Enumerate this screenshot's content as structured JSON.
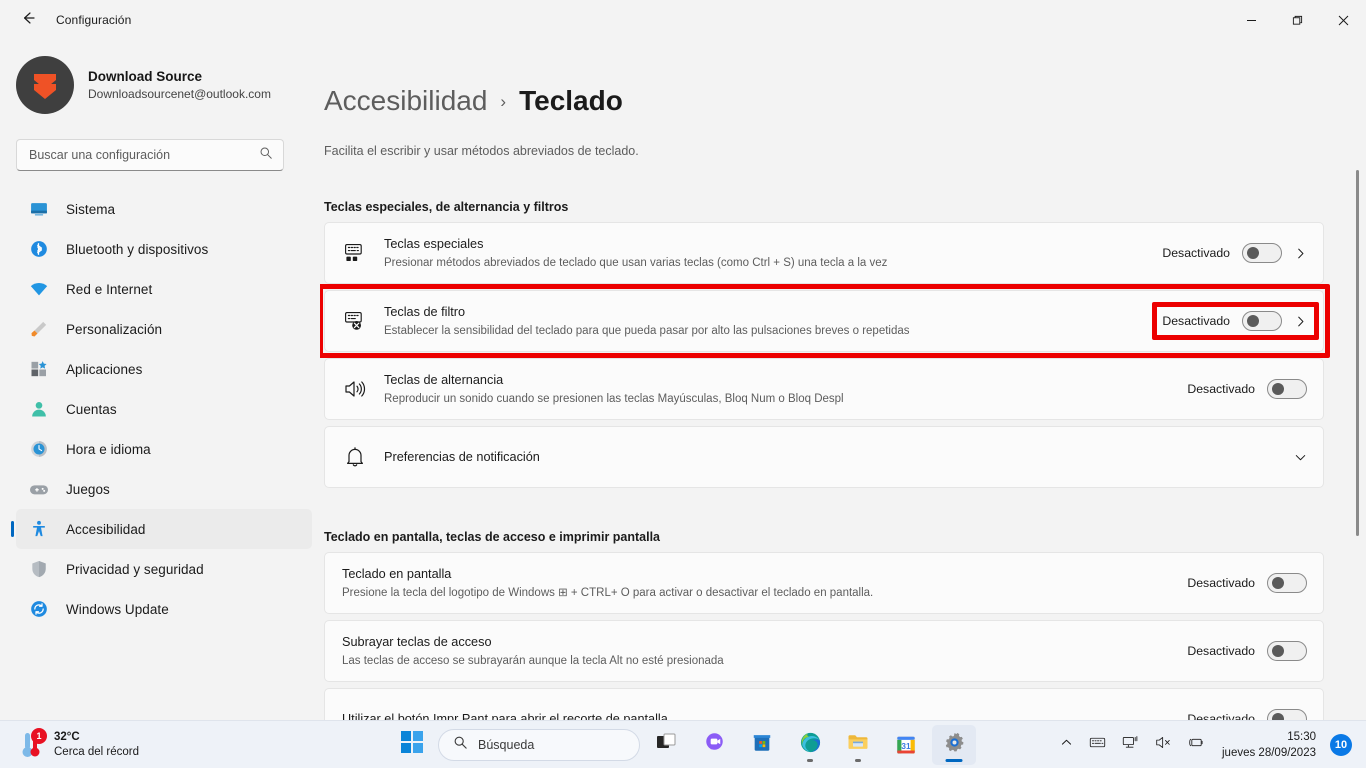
{
  "window": {
    "title": "Configuración",
    "back_icon": "back-arrow-icon",
    "minimize": "minimize-icon",
    "restore": "restore-icon",
    "close": "close-icon"
  },
  "account": {
    "name": "Download Source",
    "email": "Downloadsourcenet@outlook.com",
    "avatar_bg": "#3f3f3f",
    "avatar_accent": "#ef5226"
  },
  "search": {
    "placeholder": "Buscar una configuración",
    "value": "",
    "icon": "search-icon"
  },
  "sidebar": {
    "items": [
      {
        "label": "Sistema",
        "icon": "system-icon",
        "active": false
      },
      {
        "label": "Bluetooth y dispositivos",
        "icon": "bluetooth-icon",
        "active": false
      },
      {
        "label": "Red e Internet",
        "icon": "wifi-icon",
        "active": false
      },
      {
        "label": "Personalización",
        "icon": "brush-icon",
        "active": false
      },
      {
        "label": "Aplicaciones",
        "icon": "apps-icon",
        "active": false
      },
      {
        "label": "Cuentas",
        "icon": "account-icon",
        "active": false
      },
      {
        "label": "Hora e idioma",
        "icon": "clock-icon",
        "active": false
      },
      {
        "label": "Juegos",
        "icon": "gamepad-icon",
        "active": false
      },
      {
        "label": "Accesibilidad",
        "icon": "accessibility-icon",
        "active": true
      },
      {
        "label": "Privacidad y seguridad",
        "icon": "shield-icon",
        "active": false
      },
      {
        "label": "Windows Update",
        "icon": "update-icon",
        "active": false
      }
    ]
  },
  "page": {
    "breadcrumb_parent": "Accesibilidad",
    "breadcrumb_separator": "›",
    "breadcrumb_current": "Teclado",
    "description": "Facilita el escribir y usar métodos abreviados de teclado."
  },
  "sections": [
    {
      "title": "Teclas especiales, de alternancia y filtros",
      "rows": [
        {
          "name": "sticky-keys",
          "icon": "keyboard-sticky-icon",
          "title": "Teclas especiales",
          "subtitle": "Presionar métodos abreviados de teclado que usan varias teclas (como Ctrl + S) una tecla a la vez",
          "toggle_label": "Desactivado",
          "toggle_on": false,
          "chevron": "chevron-right-icon"
        },
        {
          "name": "filter-keys",
          "icon": "keyboard-filter-icon",
          "title": "Teclas de filtro",
          "subtitle": "Establecer la sensibilidad del teclado para que pueda pasar por alto las pulsaciones breves o repetidas",
          "toggle_label": "Desactivado",
          "toggle_on": false,
          "chevron": "chevron-right-icon",
          "highlighted": true
        },
        {
          "name": "toggle-keys",
          "icon": "speaker-icon",
          "title": "Teclas de alternancia",
          "subtitle": "Reproducir un sonido cuando se presionen las teclas Mayúsculas, Bloq Num o Bloq Despl",
          "toggle_label": "Desactivado",
          "toggle_on": false,
          "chevron": null
        },
        {
          "name": "notification-preferences",
          "icon": "bell-icon",
          "title": "Preferencias de notificación",
          "subtitle": null,
          "toggle_label": null,
          "toggle_on": null,
          "chevron": "chevron-down-icon"
        }
      ]
    },
    {
      "title": "Teclado en pantalla, teclas de acceso e imprimir pantalla",
      "rows": [
        {
          "name": "on-screen-keyboard",
          "icon": null,
          "title": "Teclado en pantalla",
          "subtitle": "Presione la tecla del logotipo de Windows ⊞ + CTRL+ O para activar o desactivar el teclado en pantalla.",
          "toggle_label": "Desactivado",
          "toggle_on": false,
          "chevron": null
        },
        {
          "name": "underline-access-keys",
          "icon": null,
          "title": "Subrayar teclas de acceso",
          "subtitle": "Las teclas de acceso se subrayarán aunque la tecla Alt no esté presionada",
          "toggle_label": "Desactivado",
          "toggle_on": false,
          "chevron": null
        },
        {
          "name": "print-screen-snip",
          "icon": null,
          "title": "Utilizar el botón Impr Pant para abrir el recorte de pantalla",
          "subtitle": null,
          "toggle_label": "Desactivado",
          "toggle_on": false,
          "chevron": null
        }
      ]
    }
  ],
  "highlight": {
    "color": "#ec0000"
  },
  "taskbar": {
    "weather": {
      "temperature": "32°C",
      "description": "Cerca del récord",
      "badge": "1",
      "icon": "thermometer-icon"
    },
    "start_icon": "windows-start-icon",
    "search": {
      "placeholder": "Búsqueda",
      "icon": "search-icon"
    },
    "apps": [
      {
        "name": "task-view",
        "icon": "task-view-icon",
        "running": false
      },
      {
        "name": "chat",
        "icon": "chat-icon",
        "running": false
      },
      {
        "name": "microsoft-store",
        "icon": "store-icon",
        "running": false
      },
      {
        "name": "microsoft-edge",
        "icon": "edge-icon",
        "running": true
      },
      {
        "name": "file-explorer",
        "icon": "folder-icon",
        "running": true
      },
      {
        "name": "calendar",
        "icon": "calendar-icon",
        "running": false,
        "day": "31"
      },
      {
        "name": "settings",
        "icon": "gear-icon",
        "running": true,
        "active": true
      }
    ],
    "tray": {
      "overflow_icon": "chevron-up-icon",
      "ime_icon": "keyboard-icon",
      "network_icon": "network-icon",
      "volume_icon": "volume-muted-icon",
      "battery_icon": "battery-charging-icon",
      "time": "15:30",
      "date": "jueves 28/09/2023",
      "notification_badge": "10"
    }
  }
}
